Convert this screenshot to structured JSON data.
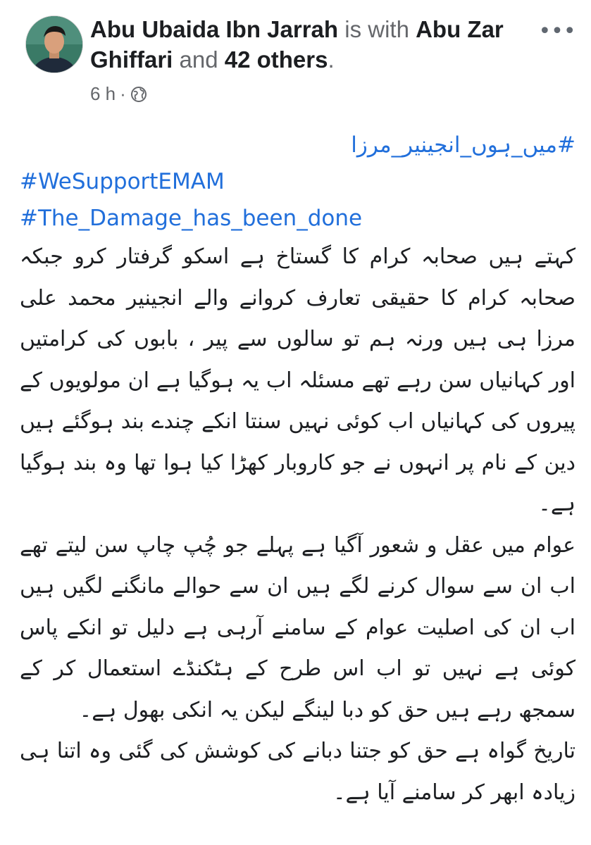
{
  "post": {
    "author": "Abu Ubaida Ibn Jarrah",
    "connector_with": "is with",
    "tagged_name": "Abu Zar Ghiffari",
    "connector_and": "and",
    "others": "42 others",
    "period": ".",
    "time": "6 h",
    "separator": "·",
    "privacy_icon": "globe-icon",
    "more_icon": "more-options-icon"
  },
  "hashtags": [
    "#میں_ہوں_انجینیر_مرزا",
    "#WeSupportEMAM",
    "#The_Damage_has_been_done"
  ],
  "paragraphs": [
    "کہتے ہیں صحابہ کرام کا گستاخ ہے اسکو گرفتار کرو جبکہ صحابہ کرام کا حقیقی تعارف کروانے والے انجینیر محمد علی مرزا ہی ہیں ورنہ ہم تو سالوں سے پیر ، بابوں کی کرامتیں اور کہانیاں سن رہے تھے مسئلہ اب یہ ہوگیا ہے ان مولویوں کے پیروں کی کہانیاں اب کوئی نہیں سنتا انکے چندے بند ہوگئے ہیں دین کے نام پر انہوں نے جو کاروبار کھڑا کیا ہوا تھا وہ بند ہوگیا ہے۔",
    "عوام میں عقل و شعور آگیا ہے پہلے جو چُپ چاپ سن لیتے تھے اب ان سے سوال کرنے لگے ہیں ان سے حوالے مانگنے لگیں ہیں اب ان کی اصلیت عوام کے سامنے آرہی ہے دلیل تو انکے پاس کوئی ہے نہیں تو اب اس طرح کے ہٹکنڈے استعمال کر کے سمجھ رہے ہیں حق کو دبا لینگے لیکن یہ انکی بھول ہے۔",
    "تاریخ گواہ ہے حق کو جتنا دبانے کی کوشش کی گئی وہ اتنا ہی زیادہ ابھر کر سامنے آیا ہے۔"
  ],
  "colors": {
    "hashtag": "#216fdb",
    "text": "#1c1e21",
    "muted": "#65676b"
  }
}
